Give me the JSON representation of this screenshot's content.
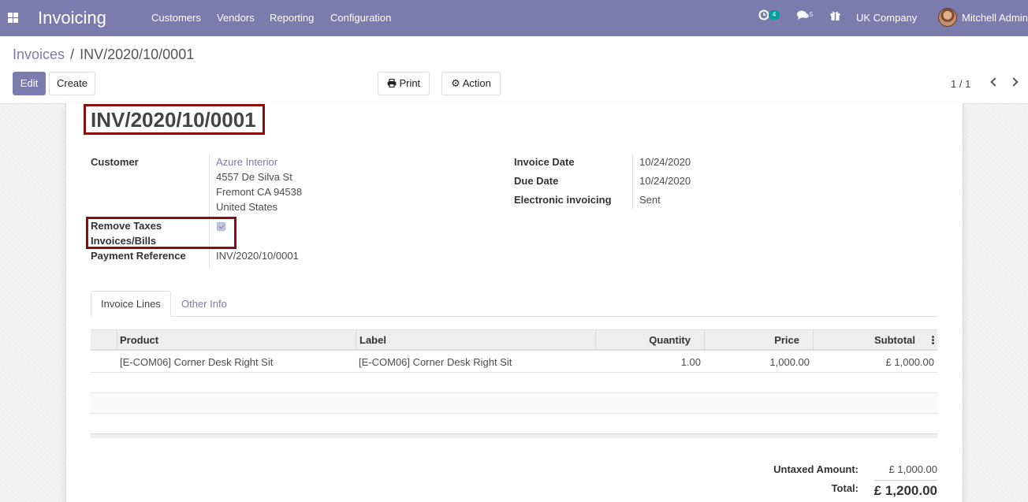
{
  "navbar": {
    "app_title": "Invoicing",
    "menu": [
      "Customers",
      "Vendors",
      "Reporting",
      "Configuration"
    ],
    "activity_count": "4",
    "message_count": "5",
    "company": "UK Company",
    "user": "Mitchell Admin"
  },
  "breadcrumb": {
    "parent": "Invoices",
    "separator": "/",
    "current": "INV/2020/10/0001"
  },
  "toolbar": {
    "edit": "Edit",
    "create": "Create",
    "print": "Print",
    "action": "Action",
    "pager": "1 / 1"
  },
  "invoice": {
    "number": "INV/2020/10/0001",
    "customer_label": "Customer",
    "customer_name": "Azure Interior",
    "address": [
      "4557 De Silva St",
      "Fremont CA 94538",
      "United States"
    ],
    "remove_taxes_label_1": "Remove Taxes",
    "remove_taxes_label_2": "Invoices/Bills",
    "remove_taxes_checked": true,
    "payment_reference_label": "Payment Reference",
    "payment_reference": "INV/2020/10/0001",
    "invoice_date_label": "Invoice Date",
    "invoice_date": "10/24/2020",
    "due_date_label": "Due Date",
    "due_date": "10/24/2020",
    "einvoicing_label": "Electronic invoicing",
    "einvoicing": "Sent"
  },
  "tabs": {
    "invoice_lines": "Invoice Lines",
    "other_info": "Other Info"
  },
  "table": {
    "headers": {
      "product": "Product",
      "label": "Label",
      "quantity": "Quantity",
      "price": "Price",
      "subtotal": "Subtotal"
    },
    "rows": [
      {
        "product": "[E-COM06] Corner Desk Right Sit",
        "label": "[E-COM06] Corner Desk Right Sit",
        "quantity": "1.00",
        "price": "1,000.00",
        "subtotal": "£ 1,000.00"
      }
    ]
  },
  "totals": {
    "untaxed_label": "Untaxed Amount:",
    "untaxed": "£ 1,000.00",
    "total_label": "Total:",
    "total": "£ 1,200.00"
  },
  "colors": {
    "brand": "#7c7bad",
    "highlight": "#8b0d0d"
  },
  "icons": [
    "apps-icon",
    "activity-clock-icon",
    "chat-icon",
    "gift-icon",
    "printer-icon",
    "gear-icon",
    "chevron-left-icon",
    "chevron-right-icon",
    "kebab-menu-icon",
    "checkmark-icon"
  ]
}
